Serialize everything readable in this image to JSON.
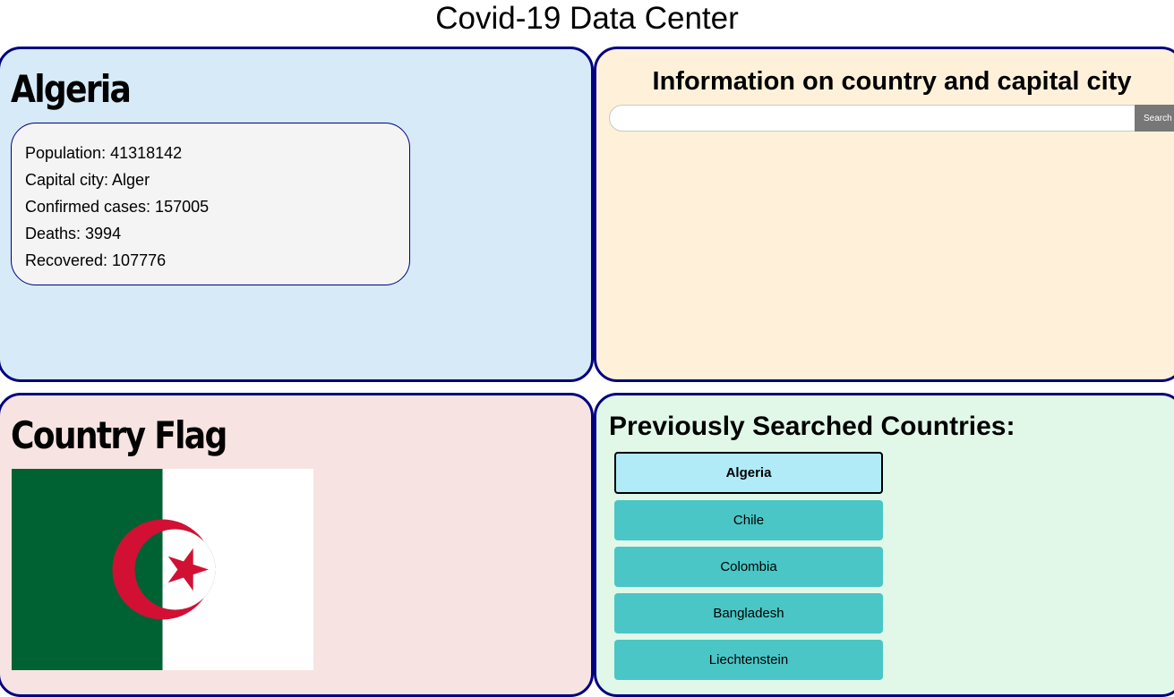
{
  "page": {
    "title": "Covid-19 Data Center"
  },
  "country": {
    "name": "Algeria",
    "rows": [
      "Population: 41318142",
      "Capital city: Alger",
      "Confirmed cases: 157005",
      "Deaths: 3994",
      "Recovered: 107776"
    ]
  },
  "search": {
    "title": "Information on country and capital city",
    "value": "",
    "placeholder": "",
    "button_label": "Search"
  },
  "flag": {
    "heading": "Country Flag",
    "colors": {
      "green": "#006233",
      "white": "#ffffff",
      "red": "#d21034"
    }
  },
  "history": {
    "title": "Previously Searched Countries:",
    "items": [
      "Algeria",
      "Chile",
      "Colombia",
      "Bangladesh",
      "Liechtenstein"
    ],
    "selected": "Algeria"
  },
  "colors": {
    "panel_border": "#000080",
    "country_bg": "#d6eaf8",
    "search_bg": "#fff1d9",
    "flag_bg": "#f7e3e1",
    "history_bg": "#e1f8e9",
    "history_button": "#4ac6c6",
    "history_button_active": "#b0ebf7"
  }
}
